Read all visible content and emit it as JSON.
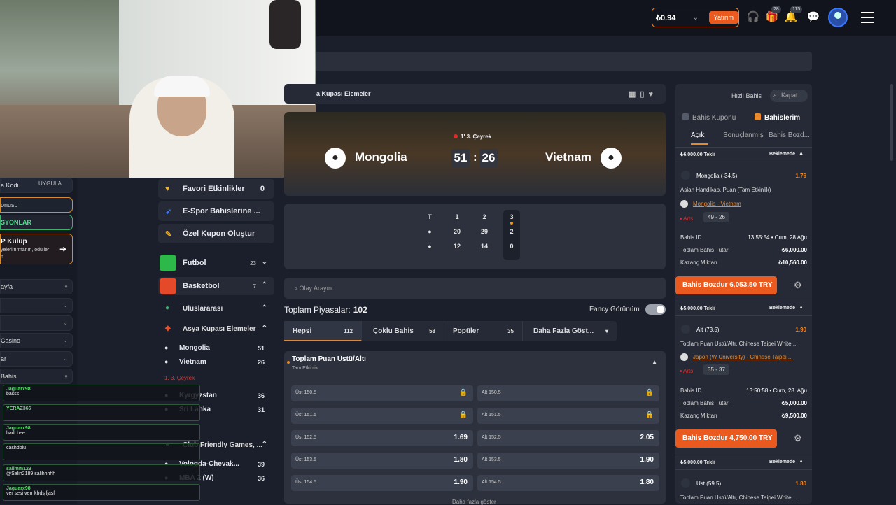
{
  "topbar": {
    "balance": "₺0.94",
    "deposit": "Yatırım",
    "gift_badge": "28",
    "notif_badge": "115"
  },
  "left": {
    "code_label": "a Kodu",
    "apply": "UYGULA",
    "bonus": "onusu",
    "promos": "SYONLAR",
    "club_title": "P Kulüp",
    "club_sub": "yeleri tırmanın, ödüller",
    "club_sub2": "n",
    "items": [
      "ayfa",
      "",
      "",
      "Casino",
      "ar",
      "Bahis"
    ]
  },
  "chat": [
    {
      "user": "Jaguarx98",
      "text": "basss"
    },
    {
      "user": "YERAZ366",
      "text": ""
    },
    {
      "user": "Jaguarx98",
      "text": "hadi bee"
    },
    {
      "user": "",
      "text": "cashdolu"
    },
    {
      "user": "salimm123",
      "text": "@Salih2189 salihhhhh"
    },
    {
      "user": "Jaguarx98",
      "text": "ver sesi verr khdsjfjasf"
    }
  ],
  "mside": {
    "favorites": "Favori Etkinlikler",
    "favorites_n": "0",
    "esports": "E-Spor Bahislerine ...",
    "custom": "Özel Kupon Oluştur",
    "football": "Futbol",
    "football_n": "23",
    "basketball": "Basketbol",
    "basketball_n": "7",
    "intl": "Uluslararası",
    "asia": "Asya Kupası Elemeler",
    "t1": "Mongolia",
    "t1n": "51",
    "t2": "Vietnam",
    "t2n": "26",
    "live": "1. 3. Çeyrek",
    "t3": "Kyrgyzstan",
    "t3n": "36",
    "t4": "Sri Lanka",
    "t4n": "31",
    "club": "Club Friendly Games, ...",
    "t5": "Vologda-Chevak...",
    "t5n": "39",
    "t6": "MBA 2 (W)",
    "t6n": "36"
  },
  "match": {
    "breadcrumb": "a Kupası Elemeler",
    "quarter": "1' 3. Çeyrek",
    "home": "Mongolia",
    "away": "Vietnam",
    "home_score": "51",
    "away_score": "26"
  },
  "quarters": {
    "headers": [
      "T",
      "1",
      "2",
      "3"
    ],
    "home": [
      "20",
      "29",
      "2"
    ],
    "away": [
      "12",
      "14",
      "0"
    ]
  },
  "search": {
    "placeholder": "Olay Arayın"
  },
  "markets": {
    "label": "Toplam Piyasalar:",
    "count": "102",
    "fancy": "Fancy Görünüm"
  },
  "tabs": [
    {
      "label": "Hepsi",
      "n": "112"
    },
    {
      "label": "Çoklu Bahis",
      "n": "58"
    },
    {
      "label": "Popüler",
      "n": "35"
    },
    {
      "label": "Daha Fazla Göst...",
      "n": ""
    }
  ],
  "market": {
    "title": "Toplam Puan Üstü/Altı",
    "subtitle": "Tam Etkinlik",
    "rows": [
      [
        "Üst 150.5",
        "",
        "Alt 150.5",
        ""
      ],
      [
        "Üst 151.5",
        "",
        "Alt 151.5",
        ""
      ],
      [
        "Üst 152.5",
        "1.69",
        "Alt 152.5",
        "2.05"
      ],
      [
        "Üst 153.5",
        "1.80",
        "Alt 153.5",
        "1.90"
      ],
      [
        "Üst 154.5",
        "1.90",
        "Alt 154.5",
        "1.80"
      ]
    ],
    "more": "Daha fazla göster"
  },
  "right": {
    "quick": "Hızlı Bahis",
    "close": "Kapat",
    "coupon": "Bahis Kuponu",
    "mybets": "Bahislerim",
    "open": "Açık",
    "settled": "Sonuçlanmış",
    "cashtab": "Bahis Bozd...",
    "bets": [
      {
        "head": "₺6,000.00 Tekli",
        "status": "Beklemede",
        "sel": "Mongolia (-34.5)",
        "odds": "1.76",
        "market": "Asian Handikap, Puan (Tam Etkinlik)",
        "event": "Mongolia - Vietnam",
        "live": "Arts",
        "score": "49 - 26",
        "id_label": "Bahis ID",
        "id_val": "13:55:54 • Cum, 28 Ağu",
        "stake_label": "Toplam Bahis Tutarı",
        "stake": "₺6,000.00",
        "win_label": "Kazanç Miktarı",
        "win": "₺10,560.00",
        "cashout": "Bahis Bozdur 6,053.50 TRY"
      },
      {
        "head": "₺5,000.00 Tekli",
        "status": "Beklemede",
        "sel": "Alt (73.5)",
        "odds": "1.90",
        "market": "Toplam Puan Üstü/Altı, Chinese Taipei White ...",
        "event": "Japon (W University) - Chinese Taipei ...",
        "live": "Arts",
        "score": "35 - 37",
        "id_label": "Bahis ID",
        "id_val": "13:50:58 • Cum, 28. Ağu",
        "stake_label": "Toplam Bahis Tutarı",
        "stake": "₺5,000.00",
        "win_label": "Kazanç Miktarı",
        "win": "₺9,500.00",
        "cashout": "Bahis Bozdur 4,750.00 TRY"
      },
      {
        "head": "₺5,000.00 Tekli",
        "status": "Beklemede",
        "sel": "Üst (59.5)",
        "odds": "1.80",
        "market": "Toplam Puan Üstü/Altı, Chinese Taipei White ..."
      }
    ]
  },
  "colors": {
    "accent": "#ea5a1f",
    "orange": "#e8892c",
    "live_red": "#e02a2a"
  }
}
